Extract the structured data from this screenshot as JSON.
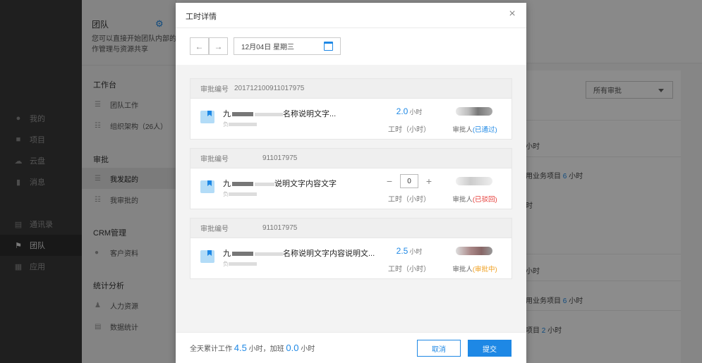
{
  "nav": {
    "items": [
      {
        "label": "我的",
        "icon": "user-icon"
      },
      {
        "label": "项目",
        "icon": "project-icon"
      },
      {
        "label": "云盘",
        "icon": "cloud-icon"
      },
      {
        "label": "消息",
        "icon": "message-icon"
      },
      {
        "label": "通讯录",
        "icon": "contacts-icon"
      },
      {
        "label": "团队",
        "icon": "flag-icon",
        "active": true
      },
      {
        "label": "应用",
        "icon": "grid-icon"
      }
    ]
  },
  "team": {
    "title": "团队",
    "desc": "您可以直接开始团队内部的工作管理与资源共享",
    "desc_line1": "您可以直接开始团队内部的工",
    "desc_line2": "作管理与资源共享",
    "sections": {
      "work": "工作台",
      "work_items": [
        "团队工作",
        "组织架构（26人）"
      ],
      "approval": "审批",
      "approval_items": [
        "我发起的",
        "我审批的"
      ],
      "crm": "CRM管理",
      "crm_items": [
        "客户资料"
      ],
      "stats": "统计分析",
      "stats_items": [
        "人力资源",
        "数据统计"
      ]
    }
  },
  "main": {
    "filter": "所有审批",
    "rows": [
      {
        "text": "小时"
      },
      {
        "text_a": "用业务项目",
        "num": "6",
        "text_b": "小时"
      },
      {
        "text": "时"
      },
      {
        "text": "小时"
      },
      {
        "text_a": "用业务项目",
        "num": "6",
        "text_b": "小时"
      },
      {
        "text_a": "项目",
        "num": "2",
        "text_b": "小时"
      }
    ]
  },
  "modal": {
    "title": "工时详情",
    "date": "12月04日  星期三",
    "summary": {
      "prefix": "全天累计工作",
      "total": "4.5",
      "unit1": "小时，加班",
      "overtime": "0.0",
      "unit2": "小时"
    },
    "cancel": "取消",
    "submit": "提交",
    "cards": [
      {
        "no_label": "审批编号",
        "no": "20171210091101797​5",
        "title_a": "九",
        "title_b": "名称说明文字...",
        "sub": "负",
        "hours": "2.0",
        "unit": "小时",
        "hours_label": "工时（小时）",
        "approver_label": "审批人",
        "status": "(已通过)"
      },
      {
        "no_label": "审批编号",
        "no": "911017975",
        "title_a": "九",
        "title_b": "说明文字内容文字",
        "sub": "负",
        "stepper_value": "0",
        "hours_label": "工时（小时）",
        "approver_label": "审批人",
        "status": "(已驳回)"
      },
      {
        "no_label": "审批编号",
        "no": "911017975",
        "title_a": "九",
        "title_b": "名称说明文字内容说明文...",
        "sub": "负",
        "hours": "2.5",
        "unit": "小时",
        "hours_label": "工时（小时）",
        "approver_label": "审批人",
        "status": "(审批中)"
      }
    ]
  }
}
